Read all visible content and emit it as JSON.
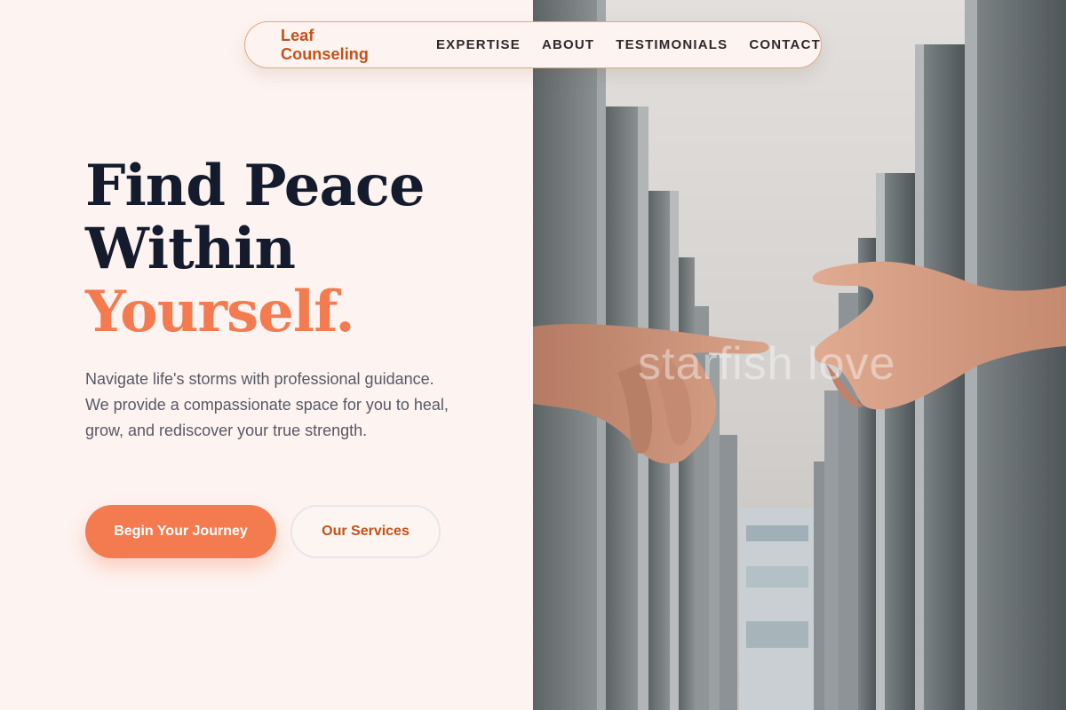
{
  "nav": {
    "brand": "Leaf Counseling",
    "links": [
      "EXPERTISE",
      "ABOUT",
      "TESTIMONIALS",
      "CONTACT"
    ]
  },
  "hero": {
    "title_line1": "Find Peace",
    "title_line2": "Within",
    "title_accent": "Yourself.",
    "description": "Navigate life's storms with professional guidance. We provide a compassionate space for you to heal, grow, and rediscover your true strength.",
    "primary_button": "Begin Your Journey",
    "secondary_button": "Our Services"
  },
  "image": {
    "watermark": "starfish love",
    "subject": "two hands reaching toward each other between tall concrete pillars"
  },
  "colors": {
    "accent": "#f47b4f",
    "brand": "#c2521a",
    "heading": "#141b2d",
    "background": "#fdf3f0"
  }
}
